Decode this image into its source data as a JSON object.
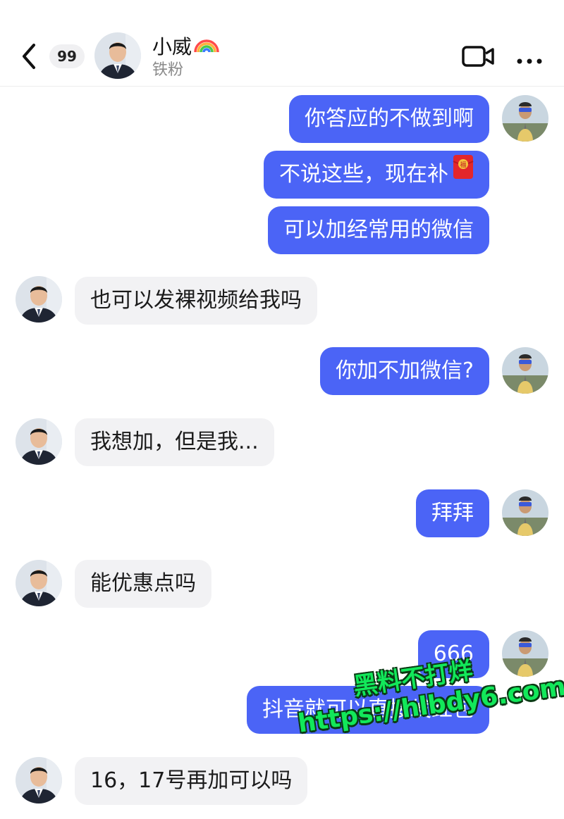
{
  "header": {
    "unread_count": "99",
    "contact_name": "小威",
    "contact_subtitle": "铁粉"
  },
  "messages": [
    {
      "direction": "out",
      "text": "你答应的不做到啊"
    },
    {
      "direction": "out",
      "text": "不说这些，现在补",
      "emoji": "red-envelope-icon"
    },
    {
      "direction": "out",
      "text": "可以加经常用的微信"
    },
    {
      "direction": "in",
      "text": "也可以发裸视频给我吗"
    },
    {
      "direction": "out",
      "text": "你加不加微信?"
    },
    {
      "direction": "in",
      "text": "我想加，但是我..."
    },
    {
      "direction": "out",
      "text": "拜拜"
    },
    {
      "direction": "in",
      "text": "能优惠点吗"
    },
    {
      "direction": "out",
      "text": "666"
    },
    {
      "direction": "out",
      "text": "抖音就可以直接发红包"
    },
    {
      "direction": "in",
      "text": "16，17号再加可以吗"
    }
  ],
  "watermark": {
    "line1": "黑料不打烊",
    "line2": "https://hlbdy6.com"
  },
  "colors": {
    "outgoing_bubble": "#4b64f6",
    "incoming_bubble": "#f2f2f4",
    "watermark": "#12e85a"
  }
}
